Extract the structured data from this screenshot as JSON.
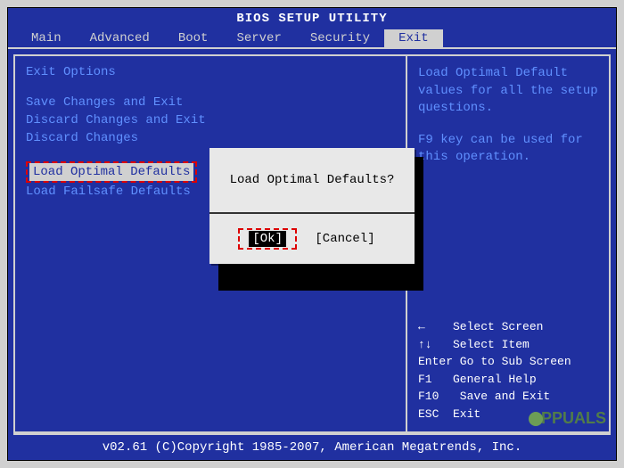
{
  "title": "BIOS SETUP UTILITY",
  "menu": {
    "items": [
      "Main",
      "Advanced",
      "Boot",
      "Server",
      "Security",
      "Exit"
    ],
    "active": "Exit"
  },
  "panel": {
    "title": "Exit Options",
    "options": [
      "Save Changes and Exit",
      "Discard Changes and Exit",
      "Discard Changes",
      "Load Optimal Defaults",
      "Load Failsafe Defaults"
    ],
    "selected_index": 3
  },
  "help": {
    "line1": "Load Optimal Default values for all the setup questions.",
    "line2": "F9 key can be used for this operation."
  },
  "nav": {
    "r1": "←    Select Screen",
    "r2": "↑↓   Select Item",
    "r3": "Enter Go to Sub Screen",
    "r4": "F1   General Help",
    "r5": "F10   Save and Exit",
    "r6": "ESC  Exit"
  },
  "dialog": {
    "message": "Load Optimal Defaults?",
    "ok": "[Ok]",
    "cancel": "[Cancel]"
  },
  "footer": "v02.61 (C)Copyright 1985-2007, American Megatrends, Inc.",
  "watermark": "PPUALS"
}
